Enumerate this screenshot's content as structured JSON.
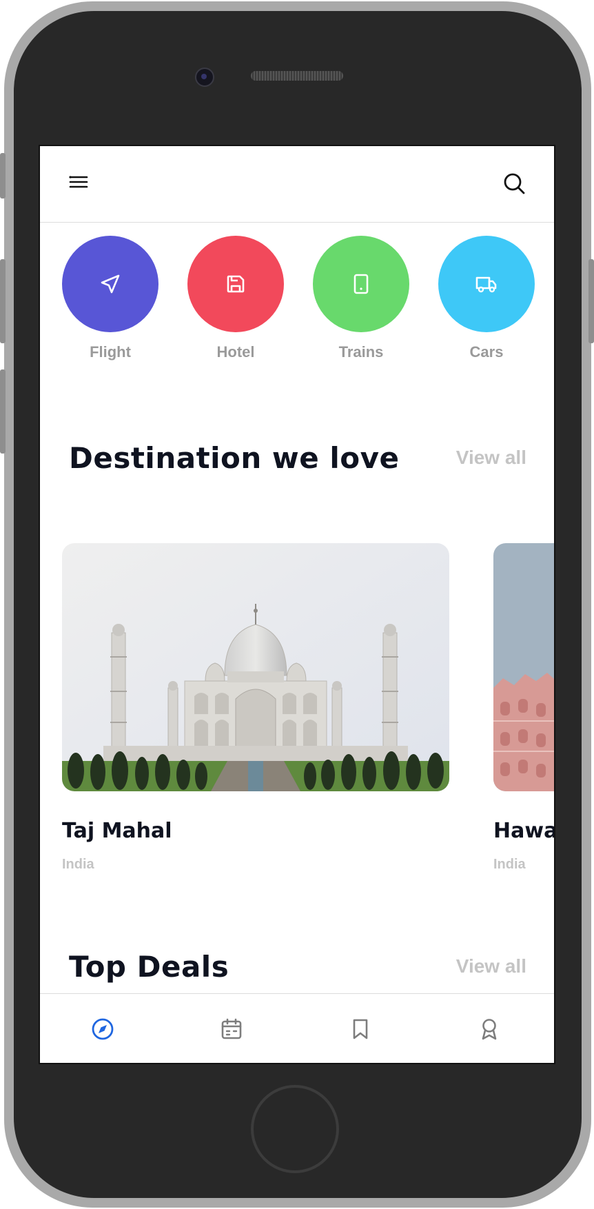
{
  "colors": {
    "flight": "#5856d6",
    "hotel": "#f2495b",
    "trains": "#68d96c",
    "cars": "#3ec8f7",
    "active_nav": "#1f66e0",
    "inactive_nav": "#7d7d7d"
  },
  "header": {
    "menu_icon": "hamburger-menu-icon",
    "search_icon": "search-icon"
  },
  "categories": [
    {
      "label": "Flight",
      "icon": "paper-plane-icon"
    },
    {
      "label": "Hotel",
      "icon": "save-disk-icon"
    },
    {
      "label": "Trains",
      "icon": "tablet-icon"
    },
    {
      "label": "Cars",
      "icon": "truck-icon"
    }
  ],
  "destinations": {
    "title": "Destination we love",
    "view_all": "View all",
    "items": [
      {
        "name": "Taj Mahal",
        "country": "India"
      },
      {
        "name": "Hawa",
        "country": "India"
      }
    ]
  },
  "top_deals": {
    "title": "Top Deals",
    "view_all": "View all"
  },
  "bottom_nav": [
    {
      "icon": "compass-icon",
      "active": true
    },
    {
      "icon": "calendar-icon",
      "active": false
    },
    {
      "icon": "bookmark-icon",
      "active": false
    },
    {
      "icon": "award-icon",
      "active": false
    }
  ]
}
